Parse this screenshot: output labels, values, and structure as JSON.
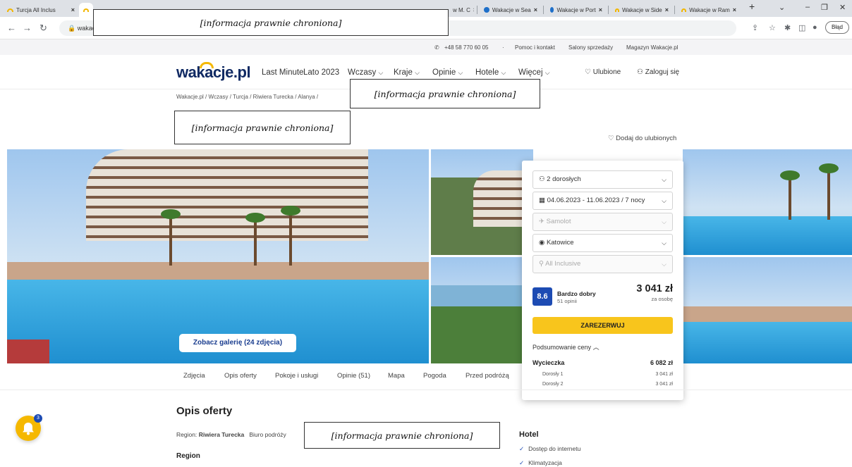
{
  "browser": {
    "tabs": [
      {
        "label": "Turcja All Inclus",
        "icon": "sun-icon",
        "active": false
      },
      {
        "label": "w M. C",
        "icon": "sun-icon",
        "active": false
      },
      {
        "label": "Wakacje w Sea",
        "icon": "globe-icon",
        "active": false
      },
      {
        "label": "Wakacje w Port",
        "icon": "globe-icon",
        "active": false
      },
      {
        "label": "Wakacje w Side",
        "icon": "sun-icon",
        "active": false
      },
      {
        "label": "Wakacje w Ram",
        "icon": "sun-icon",
        "active": false
      }
    ],
    "url": "wakacje.",
    "error_label": "Błąd"
  },
  "redacted_label": "[informacja prawnie chroniona]",
  "topbar": {
    "phone": "+48 58 770 60 05",
    "separator": "·",
    "links": [
      "Pomoc i kontakt",
      "Salony sprzedaży",
      "Magazyn Wakacje.pl"
    ]
  },
  "header": {
    "logo": "wakacje.pl",
    "menu": [
      {
        "label": "Last Minute",
        "dropdown": false
      },
      {
        "label": "Lato 2023",
        "dropdown": false
      },
      {
        "label": "Wczasy",
        "dropdown": true
      },
      {
        "label": "Kraje",
        "dropdown": true
      },
      {
        "label": "Opinie",
        "dropdown": true
      },
      {
        "label": "Hotele",
        "dropdown": true
      },
      {
        "label": "Więcej",
        "dropdown": true
      }
    ],
    "favorites": "Ulubione",
    "login": "Zaloguj się"
  },
  "breadcrumb": [
    "Wakacje.pl",
    "Wczasy",
    "Turcja",
    "Riwiera Turecka",
    "Alanya"
  ],
  "add_favorite": "Dodaj do ulubionych",
  "gallery_button": "Zobacz galerię (24 zdjęcia)",
  "booking": {
    "guests": "2 dorosłych",
    "dates": "04.06.2023 - 11.06.2023 / 7 nocy",
    "transport": "Samolot",
    "departure": "Katowice",
    "board": "All Inclusive",
    "rating_score": "8.6",
    "rating_label": "Bardzo dobry",
    "rating_count": "51 opinii",
    "price": "3 041 zł",
    "price_per": "za osobę",
    "book_button": "ZAREZERWUJ",
    "summary_label": "Podsumowanie ceny",
    "trip_label": "Wycieczka",
    "trip_total": "6 082 zł",
    "rows": [
      {
        "label": "Dorosły 1",
        "value": "3 041 zł"
      },
      {
        "label": "Dorosły 2",
        "value": "3 041 zł"
      }
    ]
  },
  "subnav": [
    "Zdjęcia",
    "Opis oferty",
    "Pokoje i usługi",
    "Opinie (51)",
    "Mapa",
    "Pogoda",
    "Przed podróżą"
  ],
  "offer": {
    "heading": "Opis oferty",
    "region_label": "Region:",
    "region_value": "Riwiera Turecka",
    "agency_label": "Biuro podróży",
    "region_heading": "Region",
    "hotel_heading": "Hotel",
    "amenities": [
      "Dostęp do internetu",
      "Klimatyzacja"
    ]
  },
  "notifications": {
    "count": "3"
  },
  "colors": {
    "brand": "#102a63",
    "accent": "#f8c51c",
    "rating": "#1d4bb3"
  }
}
